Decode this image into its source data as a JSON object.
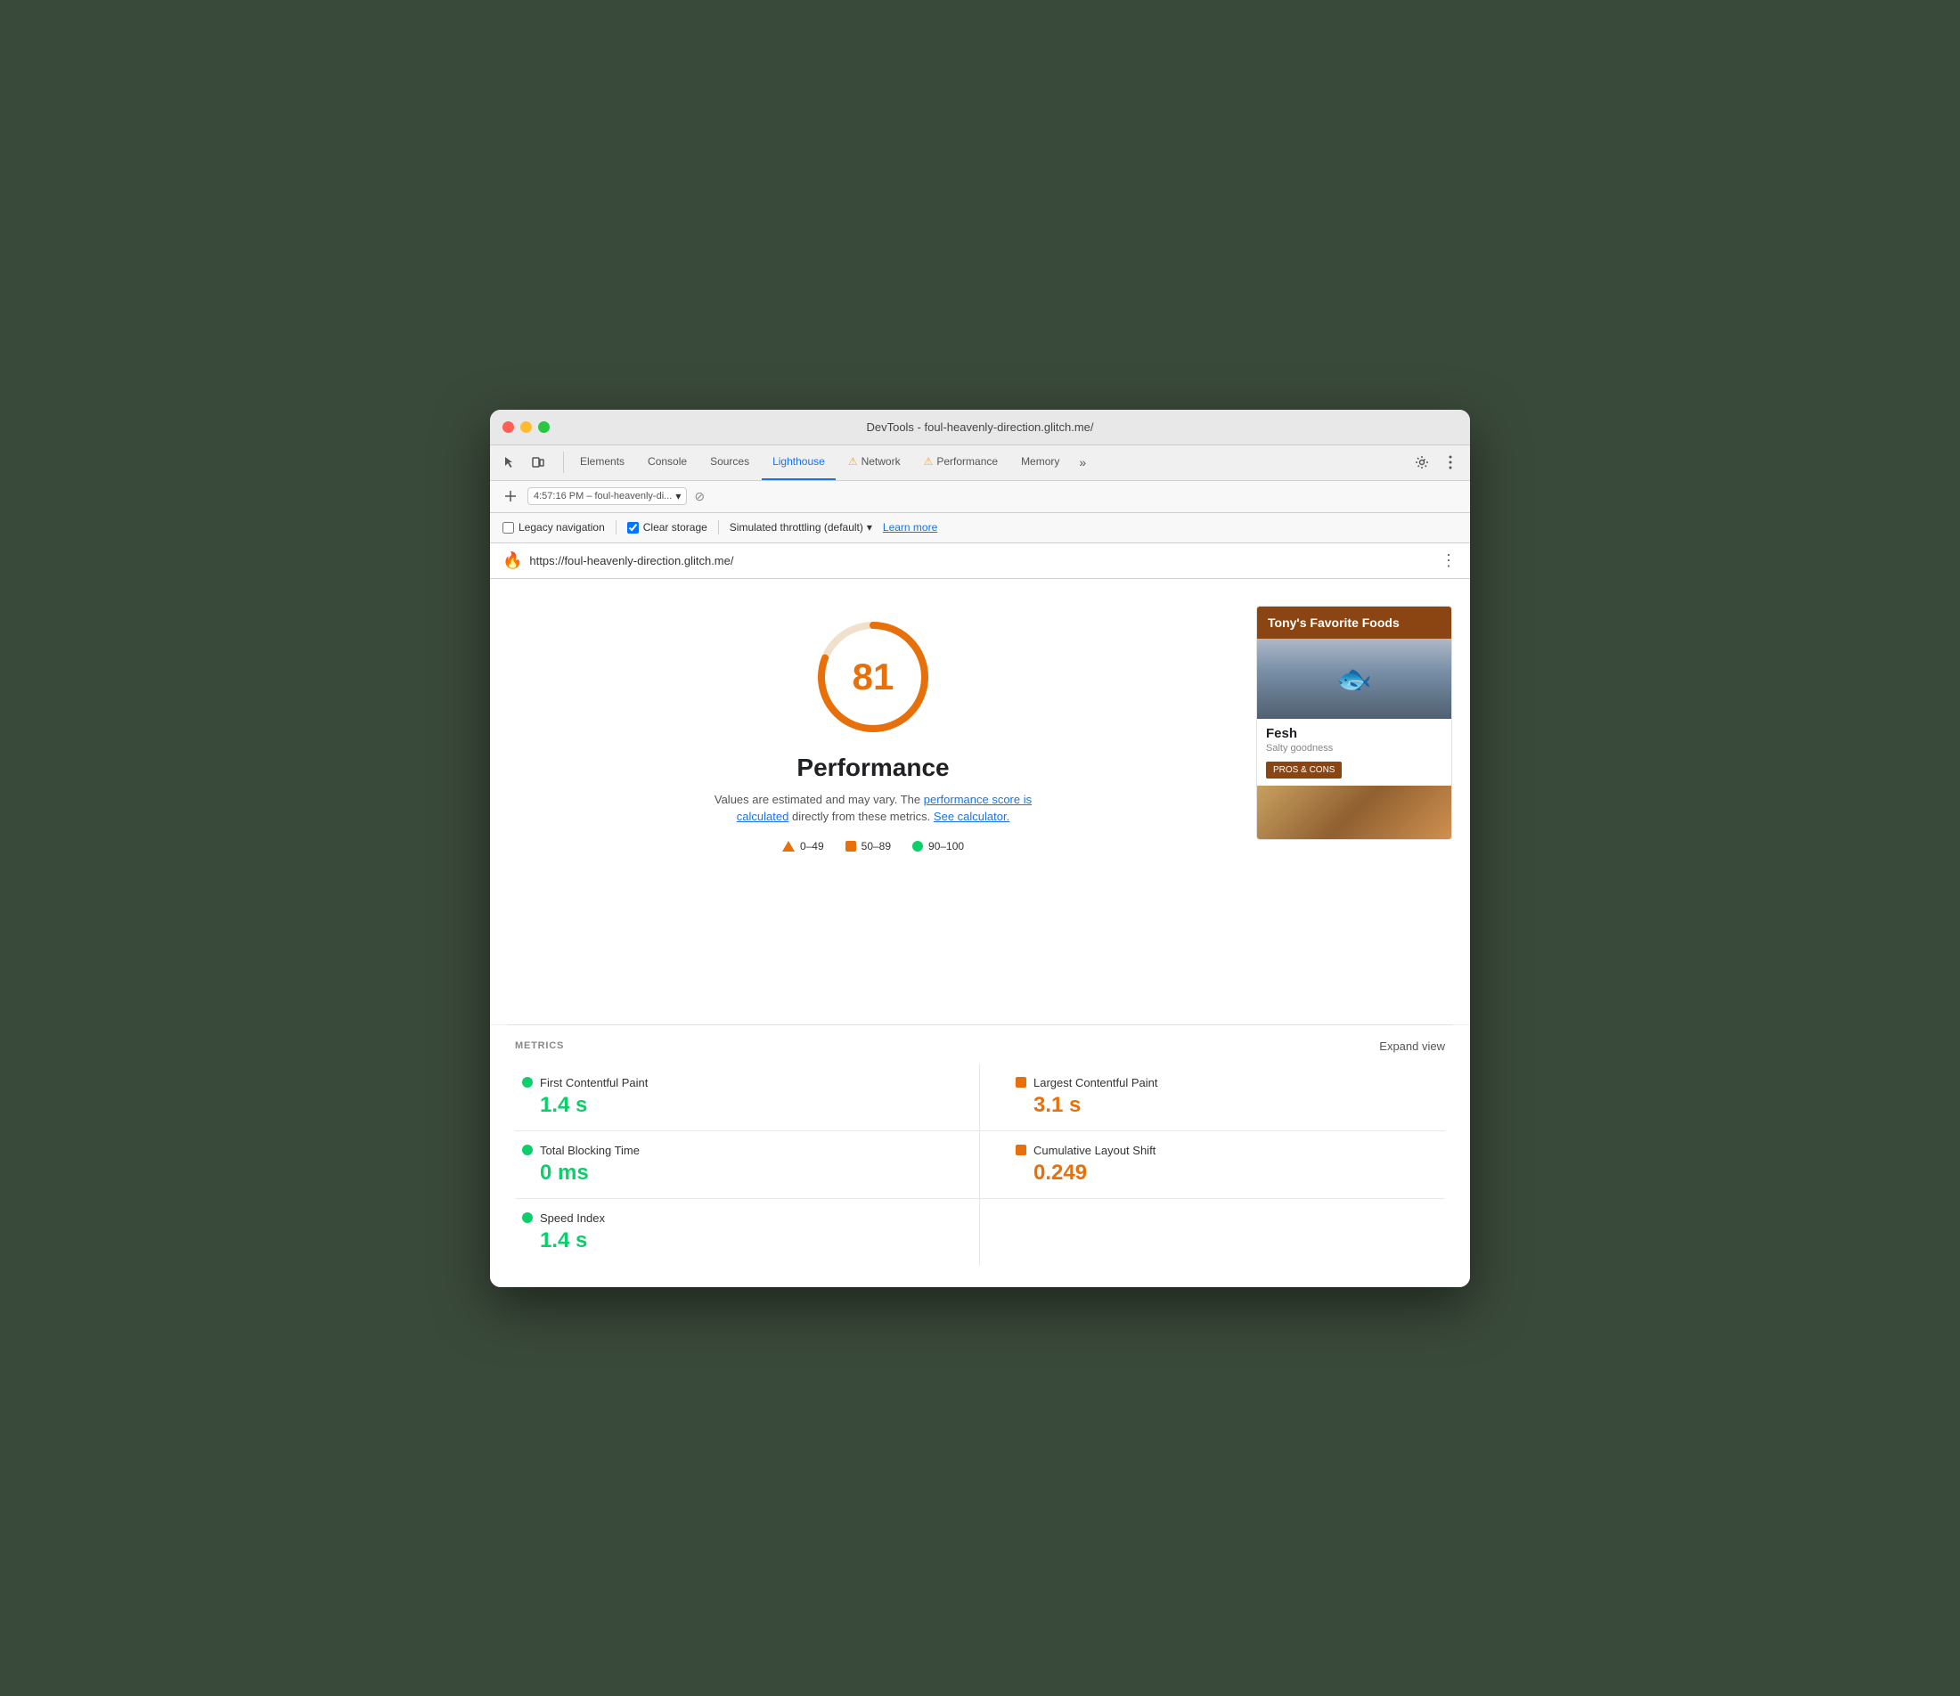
{
  "window": {
    "title": "DevTools - foul-heavenly-direction.glitch.me/"
  },
  "tabs": [
    {
      "id": "elements",
      "label": "Elements",
      "active": false,
      "warning": false
    },
    {
      "id": "console",
      "label": "Console",
      "active": false,
      "warning": false
    },
    {
      "id": "sources",
      "label": "Sources",
      "active": false,
      "warning": false
    },
    {
      "id": "lighthouse",
      "label": "Lighthouse",
      "active": true,
      "warning": false
    },
    {
      "id": "network",
      "label": "Network",
      "active": false,
      "warning": true
    },
    {
      "id": "performance",
      "label": "Performance",
      "active": false,
      "warning": true
    },
    {
      "id": "memory",
      "label": "Memory",
      "active": false,
      "warning": false
    }
  ],
  "session": {
    "label": "4:57:16 PM – foul-heavenly-di..."
  },
  "options": {
    "legacy_navigation": {
      "label": "Legacy navigation",
      "checked": false
    },
    "clear_storage": {
      "label": "Clear storage",
      "checked": true
    },
    "throttling": {
      "label": "Simulated throttling (default)"
    },
    "learn_more": "Learn more"
  },
  "url_bar": {
    "url": "https://foul-heavenly-direction.glitch.me/",
    "icon": "🔥"
  },
  "score": {
    "value": 81,
    "title": "Performance",
    "description_plain": "Values are estimated and may vary. The",
    "description_link1": "performance score is calculated",
    "description_mid": "directly from these metrics.",
    "description_link2": "See calculator.",
    "circle_color": "#e8700a",
    "circle_bg": "#f0e0cc"
  },
  "legend": [
    {
      "type": "triangle",
      "range": "0–49",
      "color": "#e8700a"
    },
    {
      "type": "square",
      "range": "50–89",
      "color": "#e8700a"
    },
    {
      "type": "circle",
      "range": "90–100",
      "color": "#0cce6b"
    }
  ],
  "preview": {
    "header": "Tony's Favorite Foods",
    "food_name": "Fesh",
    "food_desc": "Salty goodness",
    "button_label": "PROS & CONS"
  },
  "metrics": {
    "section_title": "METRICS",
    "expand_label": "Expand view",
    "items": [
      {
        "id": "fcp",
        "name": "First Contentful Paint",
        "value": "1.4 s",
        "status": "green"
      },
      {
        "id": "lcp",
        "name": "Largest Contentful Paint",
        "value": "3.1 s",
        "status": "orange"
      },
      {
        "id": "tbt",
        "name": "Total Blocking Time",
        "value": "0 ms",
        "status": "green"
      },
      {
        "id": "cls",
        "name": "Cumulative Layout Shift",
        "value": "0.249",
        "status": "orange"
      },
      {
        "id": "si",
        "name": "Speed Index",
        "value": "1.4 s",
        "status": "green"
      }
    ]
  }
}
